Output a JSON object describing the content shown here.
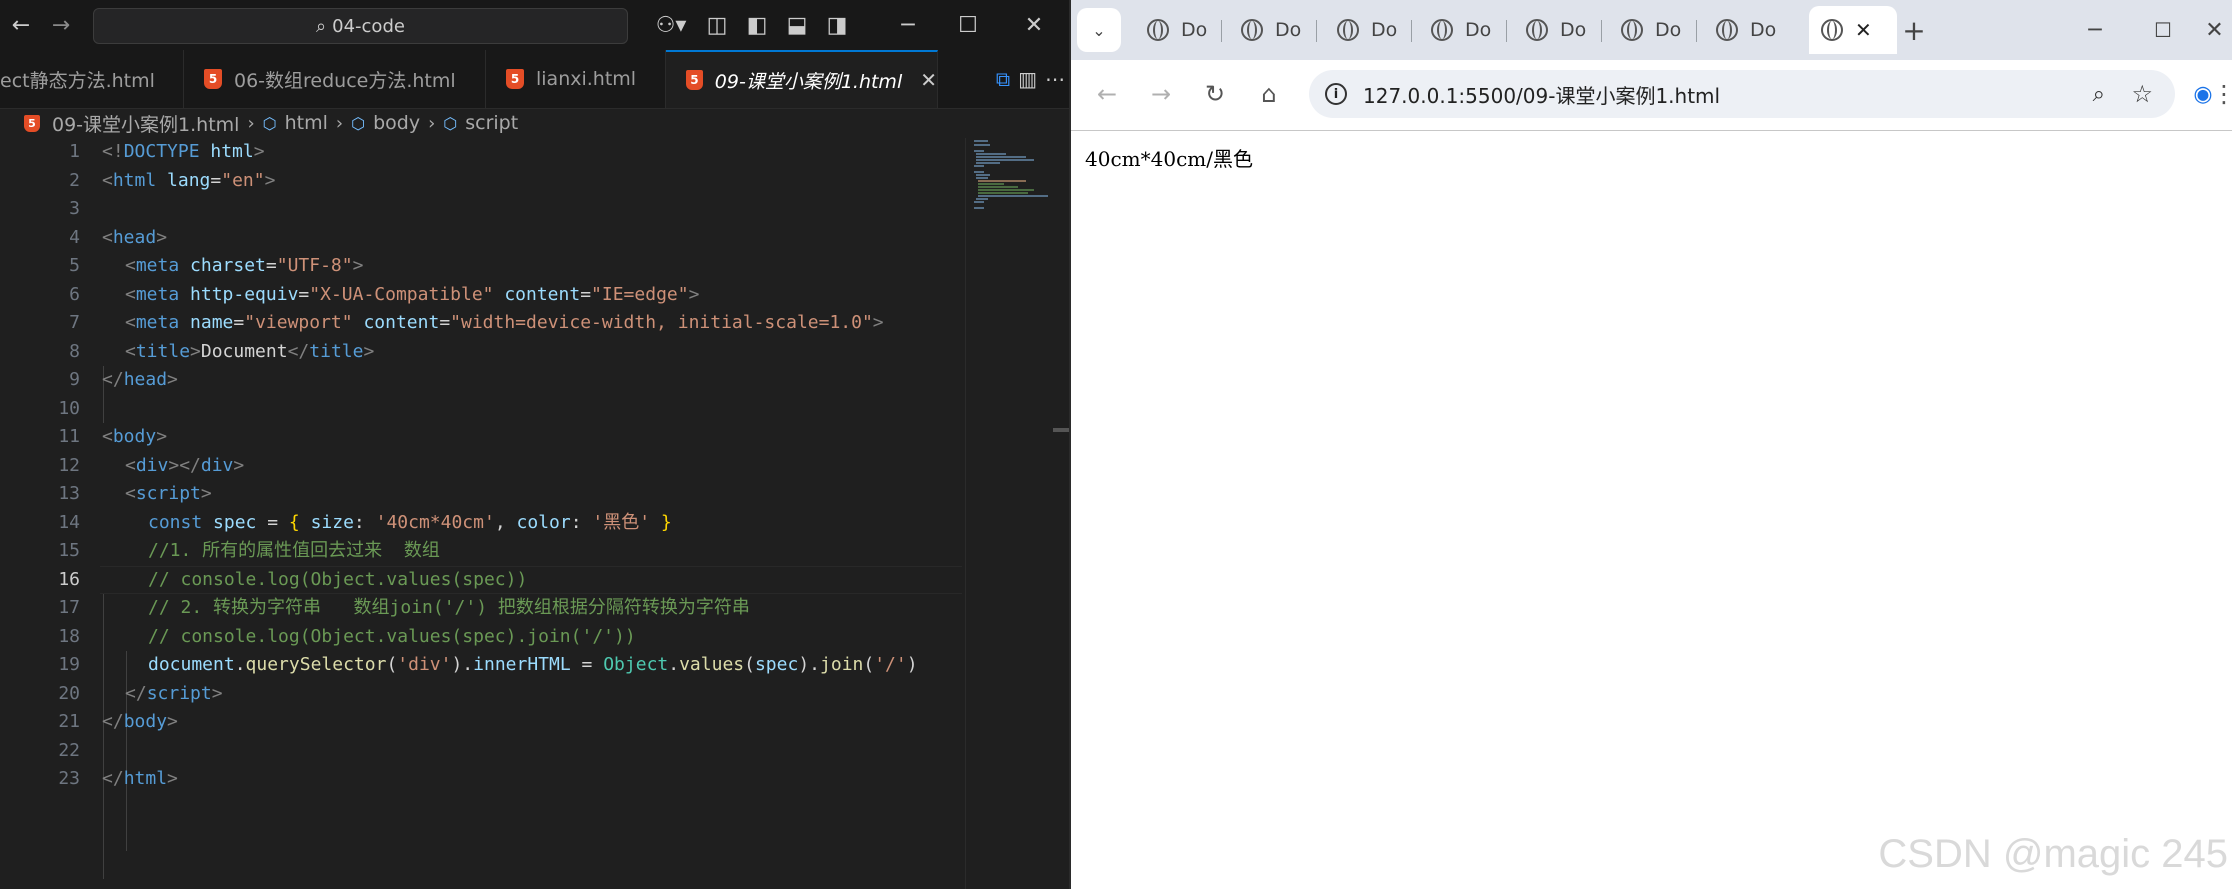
{
  "vscode": {
    "search_text": "04-code",
    "tabs": [
      {
        "label": "ect静态方法.html",
        "active": false
      },
      {
        "label": "06-数组reduce方法.html",
        "active": false
      },
      {
        "label": "lianxi.html",
        "active": false
      },
      {
        "label": "09-课堂小案例1.html",
        "active": true
      }
    ],
    "breadcrumb": [
      "09-课堂小案例1.html",
      "html",
      "body",
      "script"
    ],
    "line_numbers": [
      "1",
      "2",
      "3",
      "4",
      "5",
      "6",
      "7",
      "8",
      "9",
      "10",
      "11",
      "12",
      "13",
      "14",
      "15",
      "16",
      "17",
      "18",
      "19",
      "20",
      "21",
      "22",
      "23"
    ],
    "current_line": "16"
  },
  "browser": {
    "tab_labels": [
      "Do",
      "Do",
      "Do",
      "Do",
      "Do",
      "Do",
      "Do"
    ],
    "url": "127.0.0.1:5500/09-课堂小案例1.html",
    "page_content": "40cm*40cm/黑色",
    "watermark": "CSDN @magic 245"
  },
  "code": {
    "l1_a": "<!",
    "l1_b": "DOCTYPE",
    "l1_c": " html",
    "l1_d": ">",
    "l2_a": "<",
    "l2_b": "html",
    "l2_c": " lang",
    "l2_d": "=",
    "l2_e": "\"en\"",
    "l2_f": ">",
    "l4_a": "<",
    "l4_b": "head",
    "l4_c": ">",
    "l5_a": "<",
    "l5_b": "meta",
    "l5_c": " charset",
    "l5_d": "=",
    "l5_e": "\"UTF-8\"",
    "l5_f": ">",
    "l6_a": "<",
    "l6_b": "meta",
    "l6_c": " http-equiv",
    "l6_d": "=",
    "l6_e": "\"X-UA-Compatible\"",
    "l6_f": " content",
    "l6_g": "=",
    "l6_h": "\"IE=edge\"",
    "l6_i": ">",
    "l7_a": "<",
    "l7_b": "meta",
    "l7_c": " name",
    "l7_d": "=",
    "l7_e": "\"viewport\"",
    "l7_f": " content",
    "l7_g": "=",
    "l7_h": "\"width=device-width, initial-scale=1.0\"",
    "l7_i": ">",
    "l8_a": "<",
    "l8_b": "title",
    "l8_c": ">",
    "l8_d": "Document",
    "l8_e": "</",
    "l8_f": "title",
    "l8_g": ">",
    "l9_a": "</",
    "l9_b": "head",
    "l9_c": ">",
    "l11_a": "<",
    "l11_b": "body",
    "l11_c": ">",
    "l12_a": "<",
    "l12_b": "div",
    "l12_c": "></",
    "l12_d": "div",
    "l12_e": ">",
    "l13_a": "<",
    "l13_b": "script",
    "l13_c": ">",
    "l14_a": "const",
    "l14_b": " spec",
    "l14_c": " = ",
    "l14_d": "{",
    "l14_e": " size",
    "l14_f": ": ",
    "l14_g": "'40cm*40cm'",
    "l14_h": ", ",
    "l14_i": "color",
    "l14_j": ": ",
    "l14_k": "'黑色'",
    "l14_l": " }",
    "l15": "//1. 所有的属性值回去过来  数组",
    "l16": "// console.log(Object.values(spec))",
    "l17": "// 2. 转换为字符串   数组join('/') 把数组根据分隔符转换为字符串",
    "l18": "// console.log(Object.values(spec).join('/'))",
    "l19_a": "document",
    "l19_b": ".",
    "l19_c": "querySelector",
    "l19_d": "(",
    "l19_e": "'div'",
    "l19_f": ").",
    "l19_g": "innerHTML",
    "l19_h": " = ",
    "l19_i": "Object",
    "l19_j": ".",
    "l19_k": "values",
    "l19_l": "(",
    "l19_m": "spec",
    "l19_n": ").",
    "l19_o": "join",
    "l19_p": "(",
    "l19_q": "'/'",
    "l19_r": ")",
    "l20_a": "</",
    "l20_b": "script",
    "l20_c": ">",
    "l21_a": "</",
    "l21_b": "body",
    "l21_c": ">",
    "l23_a": "</",
    "l23_b": "html",
    "l23_c": ">"
  },
  "colors": {
    "editor_bg": "#1f1f1f",
    "accent": "#0078d4",
    "html5_icon": "#e44d26",
    "browser_strip": "#dfe3eb"
  }
}
